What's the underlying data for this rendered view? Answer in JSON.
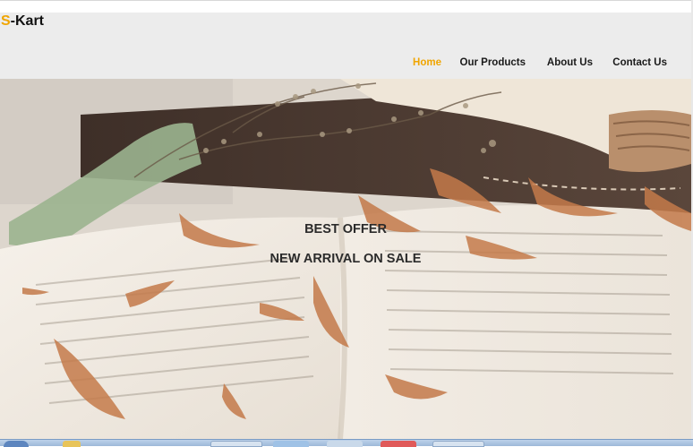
{
  "brand": {
    "logo_first_letter": "S",
    "logo_rest": "-Kart",
    "accent_color": "#f0a500"
  },
  "nav": {
    "items": [
      {
        "label": "Home",
        "active": true
      },
      {
        "label": "Our Products",
        "active": false
      },
      {
        "label": "About Us",
        "active": false
      },
      {
        "label": "Contact Us",
        "active": false
      }
    ]
  },
  "hero": {
    "headline": "BEST OFFER",
    "subheadline": "NEW ARRIVAL ON SALE",
    "background_description_icon": "open-books-with-dried-flowers-image"
  },
  "taskbar": {
    "icons": [
      "start-orb-icon",
      "folder-icon",
      "chrome-icon",
      "explorer-icon",
      "media-icon",
      "opera-icon",
      "app-icon"
    ]
  }
}
